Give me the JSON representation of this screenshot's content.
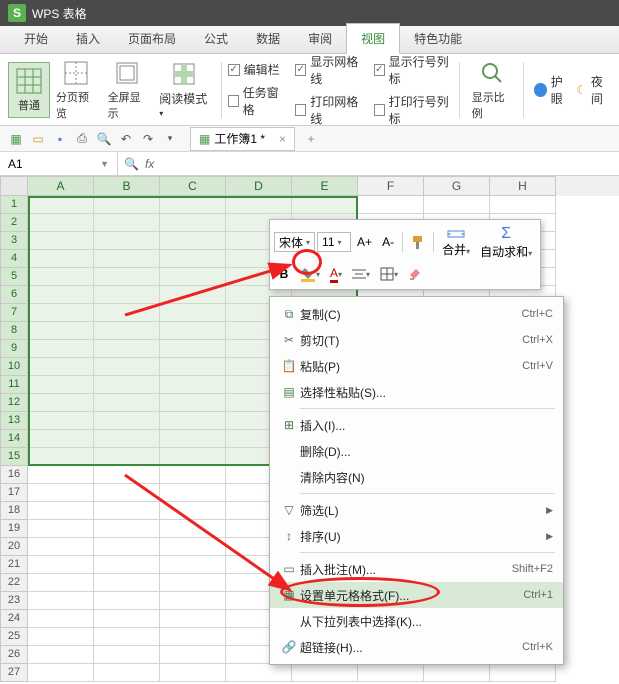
{
  "app": {
    "title": "WPS 表格"
  },
  "tabs": [
    "开始",
    "插入",
    "页面布局",
    "公式",
    "数据",
    "审阅",
    "视图",
    "特色功能"
  ],
  "activeTab": 6,
  "ribbon": {
    "views": [
      {
        "label": "普通"
      },
      {
        "label": "分页预览"
      },
      {
        "label": "全屏显示"
      },
      {
        "label": "阅读模式"
      }
    ],
    "checks_col1": [
      {
        "label": "编辑栏",
        "checked": true
      },
      {
        "label": "任务窗格",
        "checked": false
      }
    ],
    "checks_col2": [
      {
        "label": "显示网格线",
        "checked": true
      },
      {
        "label": "打印网格线",
        "checked": false
      }
    ],
    "checks_col3": [
      {
        "label": "显示行号列标",
        "checked": true
      },
      {
        "label": "打印行号列标",
        "checked": false
      }
    ],
    "zoom_label": "显示比例",
    "extra": [
      {
        "label": "护眼"
      },
      {
        "label": "夜间"
      }
    ]
  },
  "doc": {
    "name": "工作簿1 *"
  },
  "namebox": "A1",
  "fx": "fx",
  "columns": [
    "A",
    "B",
    "C",
    "D",
    "E",
    "F",
    "G",
    "H"
  ],
  "rows": [
    1,
    2,
    3,
    4,
    5,
    6,
    7,
    8,
    9,
    10,
    11,
    12,
    13,
    14,
    15,
    16,
    17,
    18,
    19,
    20,
    21,
    22,
    23,
    24,
    25,
    26,
    27
  ],
  "mini": {
    "font": "宋体",
    "size": "11",
    "merge": "合并",
    "autosum": "自动求和"
  },
  "ctx": [
    {
      "icon": "copy",
      "label": "复制(C)",
      "sc": "Ctrl+C"
    },
    {
      "icon": "cut",
      "label": "剪切(T)",
      "sc": "Ctrl+X"
    },
    {
      "icon": "paste",
      "label": "粘贴(P)",
      "sc": "Ctrl+V"
    },
    {
      "icon": "paste-special",
      "label": "选择性粘贴(S)..."
    },
    {
      "divider": true
    },
    {
      "icon": "insert",
      "label": "插入(I)..."
    },
    {
      "label": "删除(D)..."
    },
    {
      "label": "清除内容(N)"
    },
    {
      "divider": true
    },
    {
      "icon": "filter",
      "label": "筛选(L)",
      "sub": true
    },
    {
      "icon": "sort",
      "label": "排序(U)",
      "sub": true
    },
    {
      "divider": true
    },
    {
      "icon": "comment",
      "label": "插入批注(M)...",
      "sc": "Shift+F2"
    },
    {
      "icon": "format",
      "label": "设置单元格格式(F)...",
      "sc": "Ctrl+1",
      "hov": true
    },
    {
      "label": "从下拉列表中选择(K)..."
    },
    {
      "icon": "link",
      "label": "超链接(H)...",
      "sc": "Ctrl+K"
    }
  ]
}
